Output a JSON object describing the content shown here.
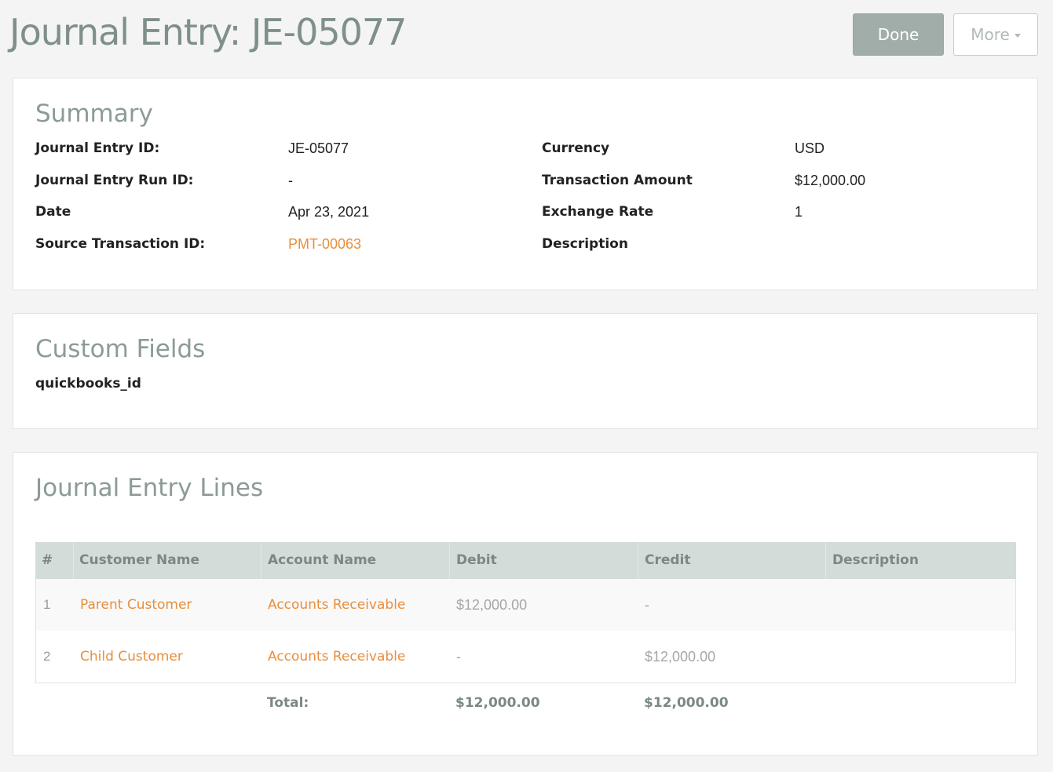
{
  "page": {
    "title": "Journal Entry: JE-05077",
    "done_label": "Done",
    "more_label": "More"
  },
  "summary": {
    "title": "Summary",
    "left": [
      {
        "label": "Journal Entry ID:",
        "value": "JE-05077"
      },
      {
        "label": "Journal Entry Run ID:",
        "value": "-"
      },
      {
        "label": "Date",
        "value": "Apr 23, 2021"
      },
      {
        "label": "Source Transaction ID:",
        "value": "PMT-00063"
      }
    ],
    "right": [
      {
        "label": "Currency",
        "value": "USD"
      },
      {
        "label": "Transaction Amount",
        "value": "$12,000.00"
      },
      {
        "label": "Exchange Rate",
        "value": "1"
      },
      {
        "label": "Description",
        "value": ""
      }
    ]
  },
  "custom_fields": {
    "title": "Custom Fields",
    "fields": [
      {
        "label": "quickbooks_id",
        "value": ""
      }
    ]
  },
  "lines": {
    "title": "Journal Entry Lines",
    "columns": [
      "#",
      "Customer Name",
      "Account Name",
      "Debit",
      "Credit",
      "Description"
    ],
    "rows": [
      {
        "num": "1",
        "customer": "Parent Customer",
        "account": "Accounts Receivable",
        "debit": "$12,000.00",
        "credit": "-",
        "description": ""
      },
      {
        "num": "2",
        "customer": "Child Customer",
        "account": "Accounts Receivable",
        "debit": "-",
        "credit": "$12,000.00",
        "description": ""
      }
    ],
    "total": {
      "label": "Total:",
      "debit": "$12,000.00",
      "credit": "$12,000.00"
    }
  },
  "colors": {
    "link": "#e88e3d",
    "header_bg": "#d3dcd8",
    "done_bg": "#a1ada9"
  }
}
